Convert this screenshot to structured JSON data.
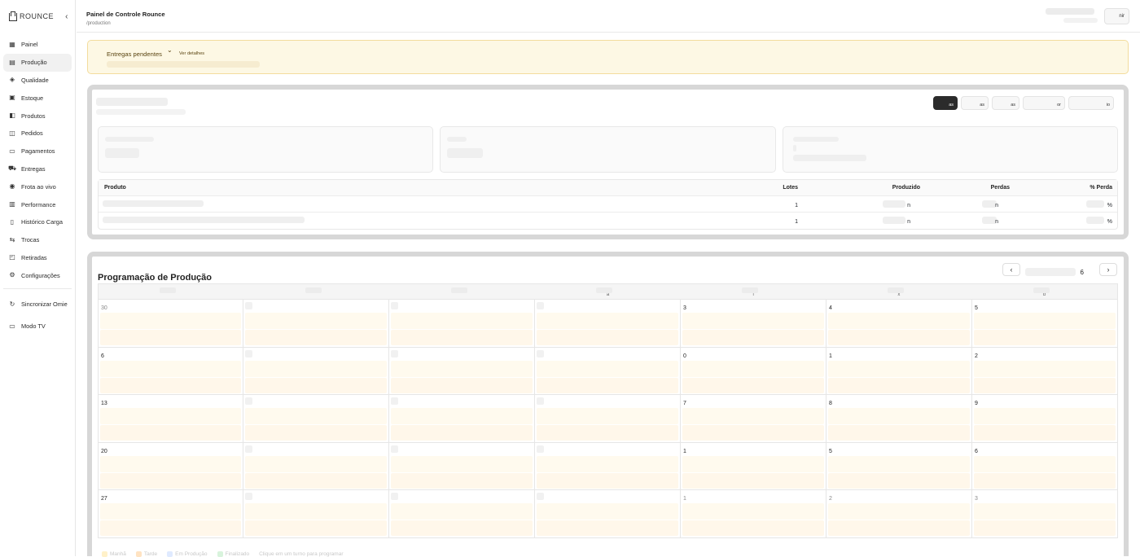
{
  "sidebar": {
    "brand": "ROUNCE",
    "collapse_icon": "chevron-left-icon",
    "items": [
      {
        "label": "Painel",
        "icon": "grid-icon",
        "glyph": "▦"
      },
      {
        "label": "Produção",
        "icon": "chart-icon",
        "glyph": "▤"
      },
      {
        "label": "Qualidade",
        "icon": "shield-icon",
        "glyph": "◈"
      },
      {
        "label": "Estoque",
        "icon": "boxes-icon",
        "glyph": "▣"
      },
      {
        "label": "Produtos",
        "icon": "package-icon",
        "glyph": "◧"
      },
      {
        "label": "Pedidos",
        "icon": "stack-icon",
        "glyph": "◫"
      },
      {
        "label": "Pagamentos",
        "icon": "card-icon",
        "glyph": "▭"
      },
      {
        "label": "Entregas",
        "icon": "truck-icon",
        "glyph": "⛟"
      },
      {
        "label": "Frota ao vivo",
        "icon": "map-pin-icon",
        "glyph": "◉"
      },
      {
        "label": "Performance",
        "icon": "bar-chart-icon",
        "glyph": "▥"
      },
      {
        "label": "Histórico Carga",
        "icon": "clipboard-icon",
        "glyph": "▯"
      },
      {
        "label": "Trocas",
        "icon": "swap-icon",
        "glyph": "⇆"
      },
      {
        "label": "Retiradas",
        "icon": "box-icon",
        "glyph": "◰"
      },
      {
        "label": "Configurações",
        "icon": "gear-icon",
        "glyph": "⚙"
      }
    ],
    "utilities": [
      {
        "label": "Sincronizar Omie",
        "icon": "refresh-icon",
        "glyph": "↻"
      },
      {
        "label": "Modo TV",
        "icon": "monitor-icon",
        "glyph": "▭"
      }
    ]
  },
  "header": {
    "title": "Painel de Controle Rounce",
    "path": "/production",
    "logout_label": "nir"
  },
  "alert": {
    "title": "Entregas pendentes",
    "link": "Ver detalhes",
    "color_bg": "#fdf8e4",
    "color_border": "#f3dc9d"
  },
  "production": {
    "segments": [
      "as",
      "as",
      "as",
      "or",
      "io"
    ],
    "table": {
      "headers": [
        "Produto",
        "Lotes",
        "Produzido",
        "Perdas",
        "% Perda"
      ],
      "rows": [
        {
          "lotes": "1",
          "produzido": "n",
          "perdas": "n",
          "perda_pct": "%"
        },
        {
          "lotes": "1",
          "produzido": "n",
          "perdas": "n",
          "perda_pct": "%"
        }
      ]
    }
  },
  "schedule": {
    "title": "Programação de Produção",
    "month_suffix": "6",
    "prev_icon": "chevron-left-icon",
    "next_icon": "chevron-right-icon",
    "weekday_fragments": [
      "",
      "",
      "",
      "a",
      "l",
      "x",
      "b"
    ],
    "weeks": [
      [
        "30",
        "",
        "",
        "",
        "3",
        "4",
        "5"
      ],
      [
        "6",
        "",
        "",
        "",
        "0",
        "1",
        "2"
      ],
      [
        "13",
        "",
        "",
        "",
        "7",
        "8",
        "9"
      ],
      [
        "20",
        "",
        "",
        "",
        "1",
        "5",
        "6"
      ],
      [
        "27",
        "",
        "",
        "",
        "1",
        "2",
        "3"
      ]
    ],
    "legend": [
      "Manhã",
      "Tarde",
      "Em Produção",
      "Finalizado",
      "Clique em um turno para programar"
    ],
    "slot_color": "#fffaee"
  }
}
